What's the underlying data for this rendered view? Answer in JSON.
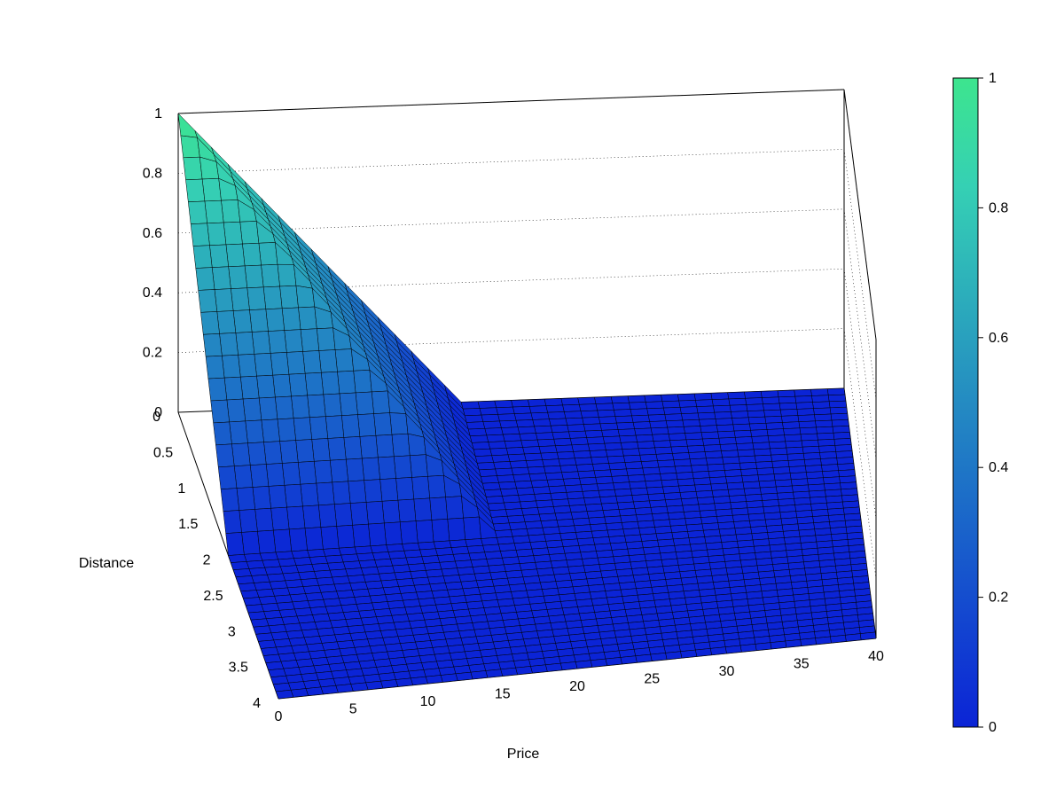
{
  "chart_data": {
    "type": "surface3d",
    "xlabel": "Price",
    "ylabel": "Distance",
    "zlabel": "",
    "x_range": [
      0,
      40
    ],
    "y_range": [
      0,
      4
    ],
    "z_range": [
      0,
      1
    ],
    "x_ticks": [
      0,
      5,
      10,
      15,
      20,
      25,
      30,
      35,
      40
    ],
    "y_ticks": [
      0,
      0.5,
      1,
      1.5,
      2,
      2.5,
      3,
      3.5,
      4
    ],
    "z_ticks": [
      0,
      0.2,
      0.4,
      0.6,
      0.8,
      1
    ],
    "colorbar_ticks": [
      0,
      0.2,
      0.4,
      0.6,
      0.8,
      1
    ],
    "grid_nx": 41,
    "grid_ny": 41,
    "surface": "z peaks at 1.0 where Price=0 and Distance=0; decreases roughly linearly and reaches ~0 by Price≈17 or Distance≈2, remaining 0 beyond",
    "peak_corner": {
      "price": 0,
      "distance": 0,
      "z": 1
    },
    "zero_plane_from": {
      "price": 17,
      "distance": 2
    },
    "colormap": [
      "#0b24d6",
      "#1346d0",
      "#1b69c9",
      "#248bc2",
      "#2caebb",
      "#35d0b4",
      "#3de58e"
    ]
  },
  "labels": {
    "xlabel": "Price",
    "ylabel": "Distance"
  }
}
